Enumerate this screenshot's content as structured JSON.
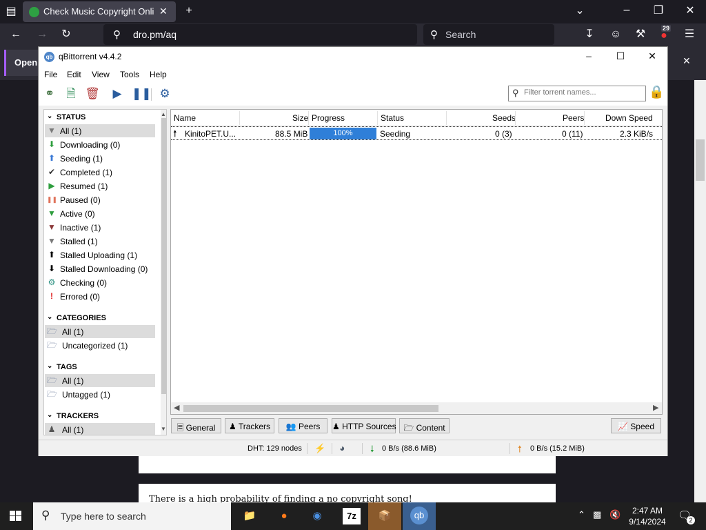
{
  "browser": {
    "tab_title": "Check Music Copyright Online",
    "url": "dro.pm/aq",
    "search_placeholder": "Search",
    "extension_badge": "29",
    "notification_button": "Open"
  },
  "webpage": {
    "visible_text": "There is a high probability of finding a no copyright song!"
  },
  "qbittorrent": {
    "title": "qBittorrent v4.4.2",
    "menu": [
      "File",
      "Edit",
      "View",
      "Tools",
      "Help"
    ],
    "filter_placeholder": "Filter torrent names...",
    "sidebar": {
      "status_header": "STATUS",
      "status_items": [
        {
          "label": "All (1)",
          "icon": "filter-icon",
          "color": "#7a7a7a"
        },
        {
          "label": "Downloading (0)",
          "icon": "arrow-down-icon",
          "color": "#2e9e3e"
        },
        {
          "label": "Seeding (1)",
          "icon": "arrow-up-icon",
          "color": "#3c7ad6"
        },
        {
          "label": "Completed (1)",
          "icon": "check-icon",
          "color": "#333333"
        },
        {
          "label": "Resumed (1)",
          "icon": "play-icon",
          "color": "#2e9e3e"
        },
        {
          "label": "Paused (0)",
          "icon": "pause-icon",
          "color": "#e0725a"
        },
        {
          "label": "Active (0)",
          "icon": "filter-icon",
          "color": "#2e9e3e"
        },
        {
          "label": "Inactive (1)",
          "icon": "filter-icon",
          "color": "#8b3a3a"
        },
        {
          "label": "Stalled (1)",
          "icon": "filter-icon",
          "color": "#7a7a7a"
        },
        {
          "label": "Stalled Uploading (1)",
          "icon": "arrow-up-icon",
          "color": "#000000"
        },
        {
          "label": "Stalled Downloading (0)",
          "icon": "arrow-down-icon",
          "color": "#000000"
        },
        {
          "label": "Checking (0)",
          "icon": "gear-icon",
          "color": "#1f8a7a"
        },
        {
          "label": "Errored (0)",
          "icon": "exclamation-icon",
          "color": "#e02020"
        }
      ],
      "categories_header": "CATEGORIES",
      "categories": [
        "All (1)",
        "Uncategorized (1)"
      ],
      "tags_header": "TAGS",
      "tags": [
        "All (1)",
        "Untagged (1)"
      ],
      "trackers_header": "TRACKERS",
      "trackers": [
        "All (1)"
      ]
    },
    "table": {
      "columns": [
        "Name",
        "Size",
        "Progress",
        "Status",
        "Seeds",
        "Peers",
        "Down Speed"
      ],
      "row": {
        "name": "KinitoPET.U...",
        "size": "88.5 MiB",
        "progress": "100%",
        "progress_value": 1.0,
        "status": "Seeding",
        "seeds": "0 (3)",
        "peers": "0 (11)",
        "down_speed": "2.3 KiB/s"
      }
    },
    "bottom_tabs": [
      "General",
      "Trackers",
      "Peers",
      "HTTP Sources",
      "Content"
    ],
    "speed_tab": "Speed",
    "statusbar": {
      "dht": "DHT: 129 nodes",
      "download": "0 B/s (88.6 MiB)",
      "upload": "0 B/s (15.2 MiB)"
    }
  },
  "taskbar": {
    "search_placeholder": "Type here to search",
    "time": "2:47 AM",
    "date": "9/14/2024",
    "notification_count": "2"
  }
}
